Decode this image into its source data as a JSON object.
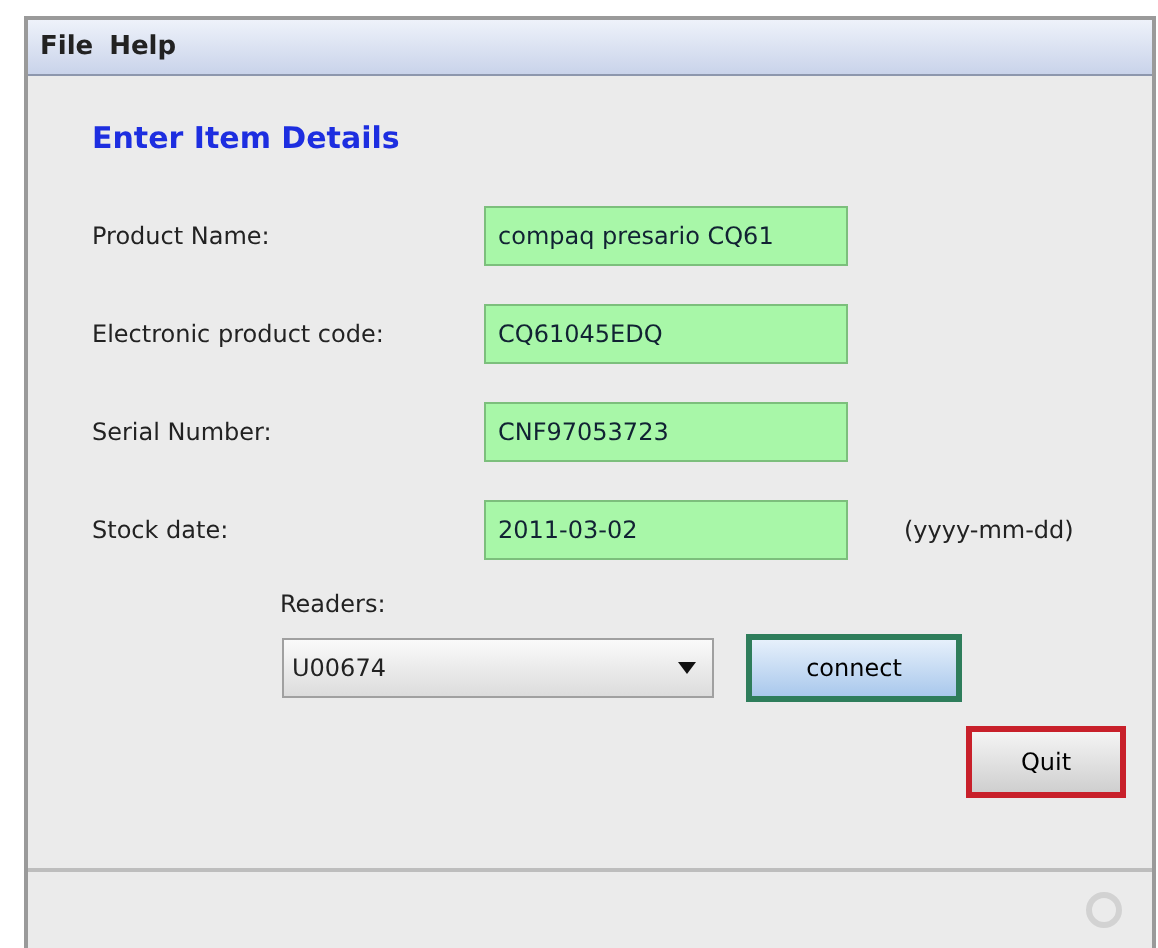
{
  "menu": [
    "File",
    "Help"
  ],
  "heading": "Enter Item Details",
  "fields": [
    {
      "label": "Product Name:",
      "value": "compaq presario CQ61"
    },
    {
      "label": "Electronic product code:",
      "value": "CQ61045EDQ"
    },
    {
      "label": "Serial Number:",
      "value": "CNF97053723"
    },
    {
      "label": "Stock date:",
      "value": "2011-03-02",
      "hint": "(yyyy-mm-dd)"
    }
  ],
  "readers": {
    "label": "Readers:",
    "value": "U00674"
  },
  "buttons": [
    {
      "label": "connect",
      "color": "#2e7d5b"
    },
    {
      "label": "Quit",
      "color": "#c8202a"
    }
  ]
}
